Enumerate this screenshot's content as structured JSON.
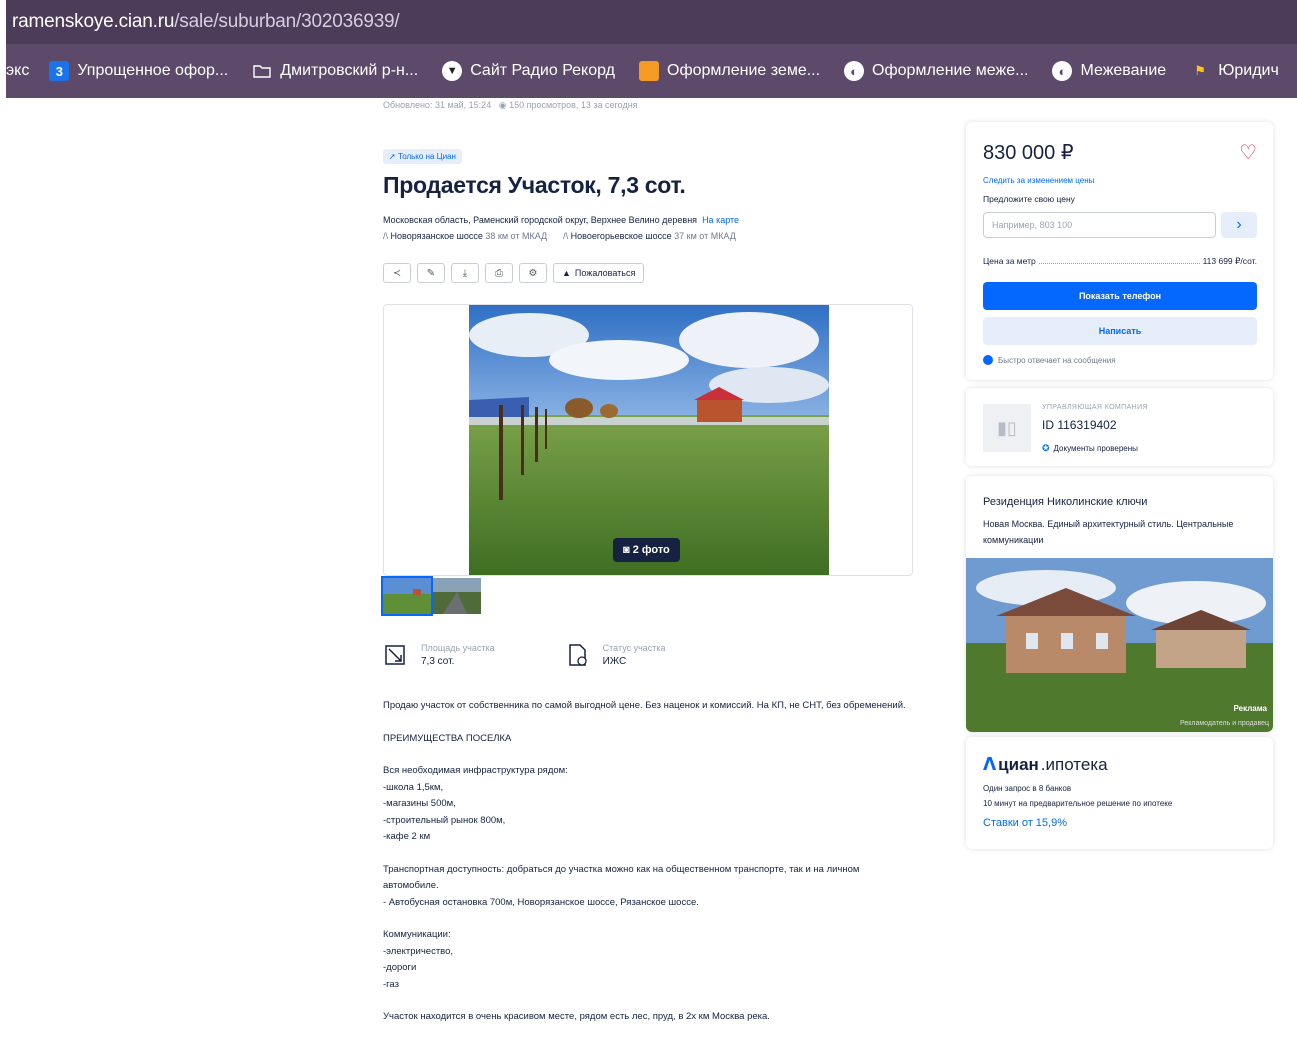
{
  "browser": {
    "url_host": "ramenskoye.cian.ru",
    "url_path": "/sale/suburban/302036939/",
    "bookmarks": [
      {
        "label": "экс",
        "icon": ""
      },
      {
        "label": "Упрощенное офор...",
        "icon": "3"
      },
      {
        "label": "Дмитровский р-н...",
        "icon": "folder-icon"
      },
      {
        "label": "Сайт Радио Рекорд",
        "icon": "record-icon"
      },
      {
        "label": "Оформление земе...",
        "icon": "puzzle-icon"
      },
      {
        "label": "Оформление меже...",
        "icon": "globe-icon"
      },
      {
        "label": "Межевание",
        "icon": "globe-icon"
      },
      {
        "label": "Юридич",
        "icon": "flag-icon"
      }
    ]
  },
  "listing": {
    "updated": "Обновлено: 31 май, 15:24",
    "views": "150 просмотров, 13 за сегодня",
    "badge": "Только на Циан",
    "title": "Продается Участок, 7,3 сот.",
    "address": "Московская область, Раменский городской округ, Верхнее Велино деревня",
    "map_link": "На карте",
    "roads": [
      {
        "name": "Новорязанское шоссе",
        "dist": "38 км от МКАД"
      },
      {
        "name": "Новоегорьевское шоссе",
        "dist": "37 км от МКАД"
      }
    ],
    "complain": "Пожаловаться",
    "photo_count": "2 фото",
    "facts": [
      {
        "label": "Площадь участка",
        "value": "7,3 сот."
      },
      {
        "label": "Статус участка",
        "value": "ИЖС"
      }
    ],
    "description": [
      "Продаю участок от собственника по самой выгодной цене. Без наценок и комиссий. На КП, не СНТ, без обременений.",
      "ПРЕИМУЩЕСТВА ПОСЕЛКА",
      "Вся необходимая инфраструктура рядом:\n-школа 1,5км,\n-магазины 500м,\n-строительный рынок 800м,\n-кафе 2 км",
      "Транспортная доступность: добраться до участка можно как на общественном транспорте, так и на личном автомобиле.\n- Автобусная остановка 700м, Новорязанское шоссе, Рязанское шоссе.",
      "Коммуникации:\n-электричество,\n-дороги\n-газ",
      "Участок находится в очень красивом месте, рядом есть лес, пруд, в 2х км Москва река."
    ]
  },
  "sidebar": {
    "price": "830 000 ₽",
    "track": "Следить за изменением цены",
    "offer_label": "Предложите свою цену",
    "offer_placeholder": "Например, 803 100",
    "per_unit_label": "Цена за метр",
    "per_unit_value": "113 699 ₽/сот.",
    "phone_btn": "Показать телефон",
    "write_btn": "Написать",
    "fast_reply": "Быстро отвечает на сообщения",
    "agent_type": "УПРАВЛЯЮЩАЯ КОМПАНИЯ",
    "agent_id": "ID 116319402",
    "agent_docs": "Документы проверены",
    "ad_title": "Резиденция Николинские ключи",
    "ad_text": "Новая Москва. Единый архитектурный стиль. Центральные коммуникации",
    "ad_tag": "Реклама",
    "ad_tag2": "Рекламодатель и продавец",
    "mortgage_brand_a": "циан",
    "mortgage_brand_b": ".ипотека",
    "mortgage_t1": "Один запрос в 8 банков",
    "mortgage_t2": "10 минут на предварительное решение по ипотеке",
    "mortgage_rate": "Ставки от 15,9%"
  }
}
